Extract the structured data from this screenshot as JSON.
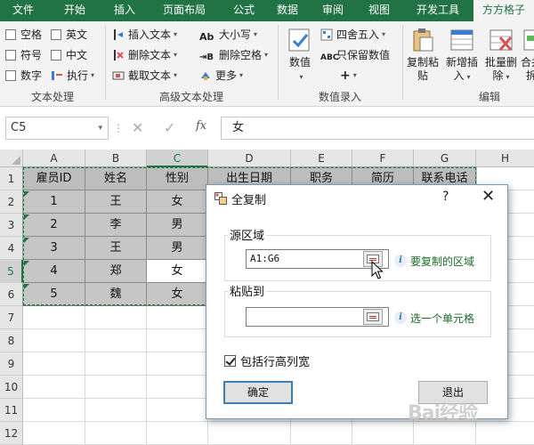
{
  "ribbon_tabs": [
    "文件",
    "开始",
    "插入",
    "页面布局",
    "公式",
    "数据",
    "审阅",
    "视图",
    "开发工具",
    "方方格子"
  ],
  "active_tab": "方方格子",
  "accent": "#217346",
  "text_group": {
    "label": "文本处理",
    "checks": [
      "空格",
      "英文",
      "符号",
      "中文",
      "数字"
    ],
    "execute": "执行"
  },
  "adv_text_group": {
    "label": "高级文本处理",
    "items": [
      "插入文本",
      "删除文本",
      "截取文本",
      "大小写",
      "删除空格",
      "更多"
    ]
  },
  "number_group": {
    "label": "数值录入",
    "big": "数值",
    "items": [
      "四舍五入",
      "只保留数值",
      "+"
    ]
  },
  "edit_group": {
    "label": "编辑",
    "items": [
      {
        "l1": "复制粘",
        "l2": "贴"
      },
      {
        "l1": "新增插",
        "l2": "入"
      },
      {
        "l1": "批量删",
        "l2": "除"
      },
      {
        "l1": "合并",
        "l2": "拆"
      }
    ]
  },
  "formula_bar": {
    "name_box": "C5",
    "cancel": "✕",
    "enter": "✓",
    "fx": "fx",
    "content": "女"
  },
  "columns": [
    "A",
    "B",
    "C",
    "D",
    "E",
    "F",
    "G",
    "H"
  ],
  "rows": [
    "1",
    "2",
    "3",
    "4",
    "5",
    "6",
    "7",
    "8",
    "9",
    "10",
    "11",
    "12"
  ],
  "table": {
    "header": [
      "雇员ID",
      "姓名",
      "性别",
      "出生日期",
      "职务",
      "简历",
      "联系电话"
    ],
    "body": [
      [
        "1",
        "王",
        "女"
      ],
      [
        "2",
        "李",
        "男"
      ],
      [
        "3",
        "王",
        "男"
      ],
      [
        "4",
        "郑",
        "女"
      ],
      [
        "5",
        "魏",
        "女"
      ]
    ]
  },
  "dialog": {
    "title": "全复制",
    "help": "?",
    "close": "✕",
    "source_label": "源区域",
    "source_value": "A1:G6",
    "source_hint": "要复制的区域",
    "paste_label": "粘贴到",
    "paste_value": "",
    "paste_hint": "选一个单元格",
    "include_label": "包括行高列宽",
    "include_checked": true,
    "ok": "确定",
    "exit": "退出"
  },
  "watermark": "Bai经验"
}
